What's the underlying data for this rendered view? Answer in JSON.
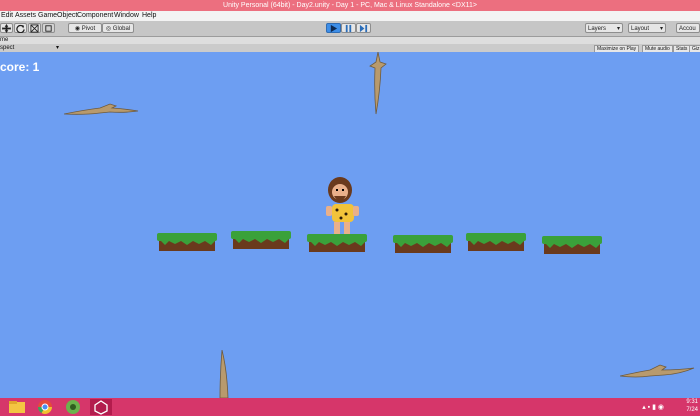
{
  "window": {
    "title": "Unity Personal (64bit) - Day2.unity - Day 1 - PC, Mac & Linux Standalone <DX11>"
  },
  "menu": [
    "Edit",
    "Assets",
    "GameObject",
    "Component",
    "Window",
    "Help"
  ],
  "toolbar": {
    "pivot_label": "Pivot",
    "global_label": "Global",
    "layers_label": "Layers",
    "layout_label": "Layout",
    "account_label": "Accou"
  },
  "game_view": {
    "tab_label": "me",
    "aspect_label": "spect",
    "maximize_label": "Maximize on Play",
    "mute_label": "Mute audio",
    "stats_label": "Stats",
    "gizmos_label": "Giz"
  },
  "game": {
    "score_text": "core: 1"
  },
  "taskbar": {
    "icons": [
      "file-explorer-icon",
      "chrome-icon",
      "app-icon",
      "unity-icon"
    ],
    "time": "9:31",
    "date": "7/24"
  },
  "colors": {
    "titlebar": "#ec6f7f",
    "sky": "#6d9ef2",
    "taskbar": "#d6366a",
    "grass": "#3aa13a",
    "dirt": "#6a3a1d"
  }
}
